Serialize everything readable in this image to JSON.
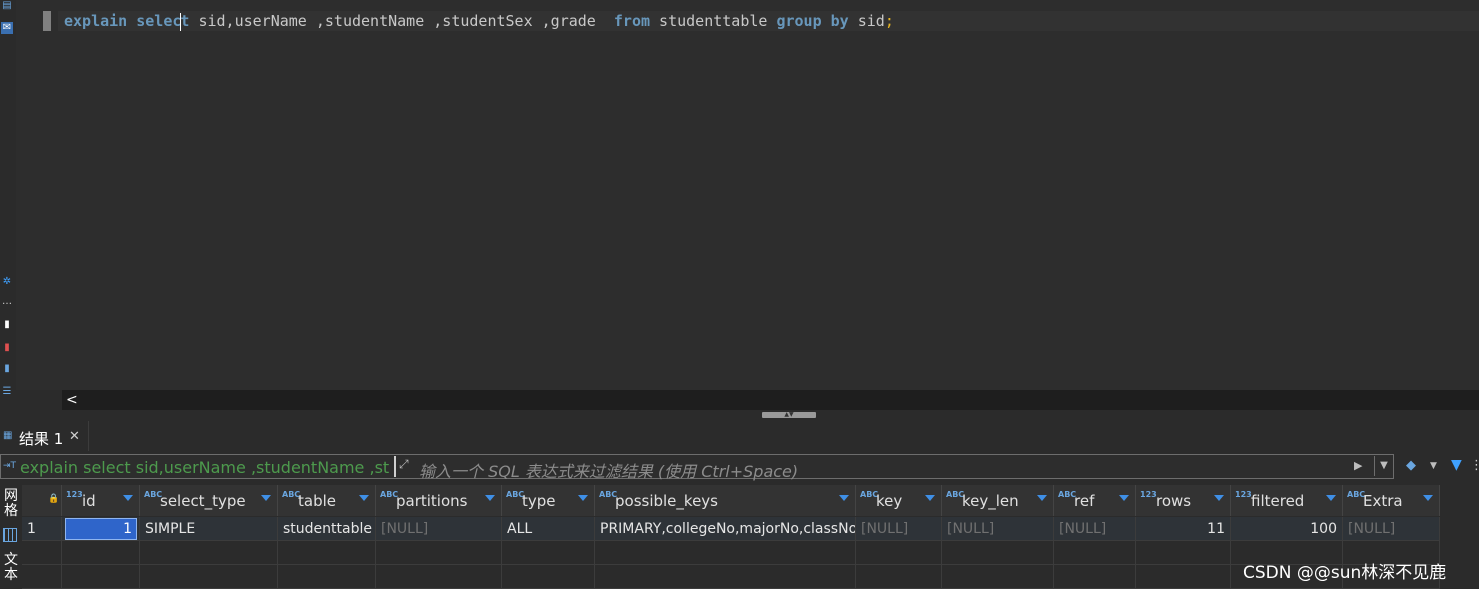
{
  "editor": {
    "sql_tokens": {
      "kw_explain": "explain",
      "kw_select_a": "selec",
      "kw_select_b": "t",
      "columns": " sid,userName ,studentName ,studentSex ,grade  ",
      "kw_from": "from",
      "table": " studenttable ",
      "kw_group": "group",
      "kw_by": "by",
      "group_col": " sid",
      "semicolon": ";"
    },
    "scroll_left_glyph": "<"
  },
  "result_tab": {
    "label": "结果 1",
    "close_glyph": "✕"
  },
  "filter": {
    "query_text": "explain select sid,userName ,studentName ,st",
    "placeholder": "输入一个 SQL 表达式来过滤结果 (使用 Ctrl+Space)"
  },
  "side_strip": {
    "grid_label": "网格",
    "text_label": "文本"
  },
  "grid": {
    "columns": [
      {
        "name": "id",
        "type_badge": "123"
      },
      {
        "name": "select_type",
        "type_badge": "ABC"
      },
      {
        "name": "table",
        "type_badge": "ABC"
      },
      {
        "name": "partitions",
        "type_badge": "ABC"
      },
      {
        "name": "type",
        "type_badge": "ABC"
      },
      {
        "name": "possible_keys",
        "type_badge": "ABC"
      },
      {
        "name": "key",
        "type_badge": "ABC"
      },
      {
        "name": "key_len",
        "type_badge": "ABC"
      },
      {
        "name": "ref",
        "type_badge": "ABC"
      },
      {
        "name": "rows",
        "type_badge": "123"
      },
      {
        "name": "filtered",
        "type_badge": "123"
      },
      {
        "name": "Extra",
        "type_badge": "ABC"
      }
    ],
    "rows": [
      {
        "row_number": "1",
        "cells": [
          "1",
          "SIMPLE",
          "studenttable",
          "[NULL]",
          "ALL",
          "PRIMARY,collegeNo,majorNo,classNo",
          "[NULL]",
          "[NULL]",
          "[NULL]",
          "11",
          "100",
          "[NULL]"
        ]
      }
    ]
  },
  "watermark": "CSDN @@sun林深不见鹿",
  "colors": {
    "keyword": "#6897bb",
    "semicolon": "#e6b422",
    "filter_query": "#4d9a4d",
    "selected_cell": "#2f65ca",
    "null_text": "#707070"
  }
}
